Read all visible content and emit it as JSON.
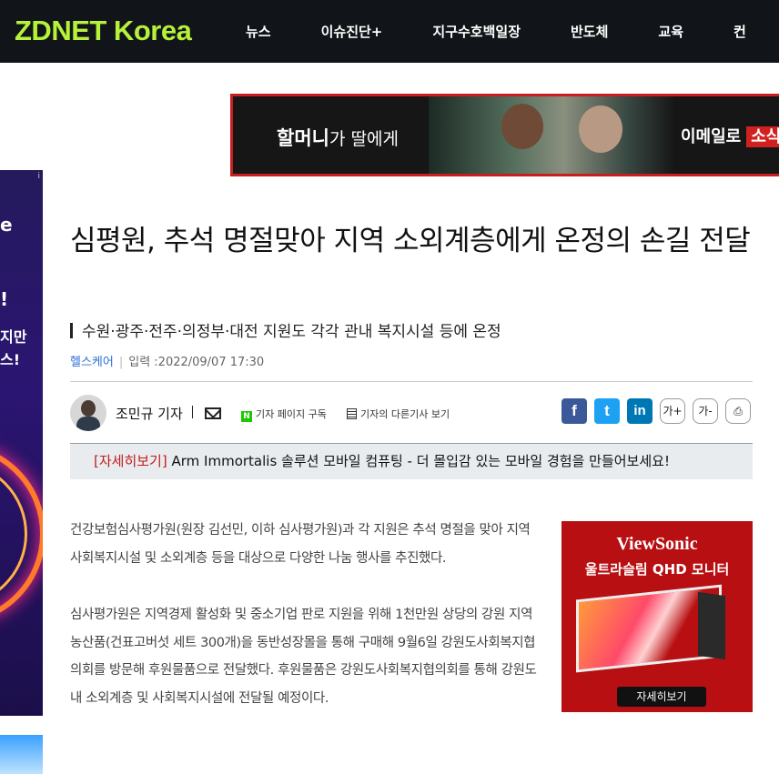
{
  "site": {
    "logo": "ZDNET Korea"
  },
  "nav": [
    "뉴스",
    "이슈진단+",
    "지구수호백일장",
    "반도체",
    "교육",
    "컨"
  ],
  "top_banner": {
    "left_bold": "할머니",
    "left_rest": "가 딸에게",
    "right_text": "이메일로",
    "right_tag": "소식"
  },
  "left_ad": {
    "lines": [
      "e",
      "!",
      "지만",
      "스!"
    ]
  },
  "article": {
    "headline": "심평원, 추석 명절맞아 지역 소외계층에게 온정의 손길 전달",
    "subhead": "수원·광주·전주·의정부·대전 지원도 각각 관내 복지시설 등에 온정",
    "category": "헬스케어",
    "date": "입력 :2022/09/07 17:30",
    "author": "조민규 기자",
    "subscribe_label": "기자 페이지 구독",
    "other_articles_label": "기자의 다른기사 보기",
    "share": {
      "facebook": "f",
      "twitter": "t",
      "linkedin": "in",
      "font_up": "가+",
      "font_down": "가-"
    },
    "paragraphs": [
      "건강보험심사평가원(원장 김선민, 이하 심사평가원)과 각 지원은 추석 명절을 맞아 지역 사회복지시설 및 소외계층 등을 대상으로 다양한 나눔 행사를 추진했다.",
      "심사평가원은 지역경제 활성화 및 중소기업 판로 지원을 위해 1천만원 상당의 강원 지역 농산품(건표고버섯 세트 300개)을 동반성장몰을 통해 구매해 9월6일 강원도사회복지협의회를 방문해 후원물품으로 전달했다. 후원물품은 강원도사회복지협의회를 통해 강원도 내 소외계층 및 사회복지시설에 전달될 예정이다."
    ]
  },
  "promo": {
    "tag": "[자세히보기]",
    "text": "Arm Immortalis 솔루션 모바일 컴퓨팅 - 더 몰입감 있는 모바일 경험을 만들어보세요!"
  },
  "side_ad": {
    "brand": "ViewSonic",
    "subtitle": "울트라슬림 QHD 모니터",
    "button": "자세히보기"
  }
}
